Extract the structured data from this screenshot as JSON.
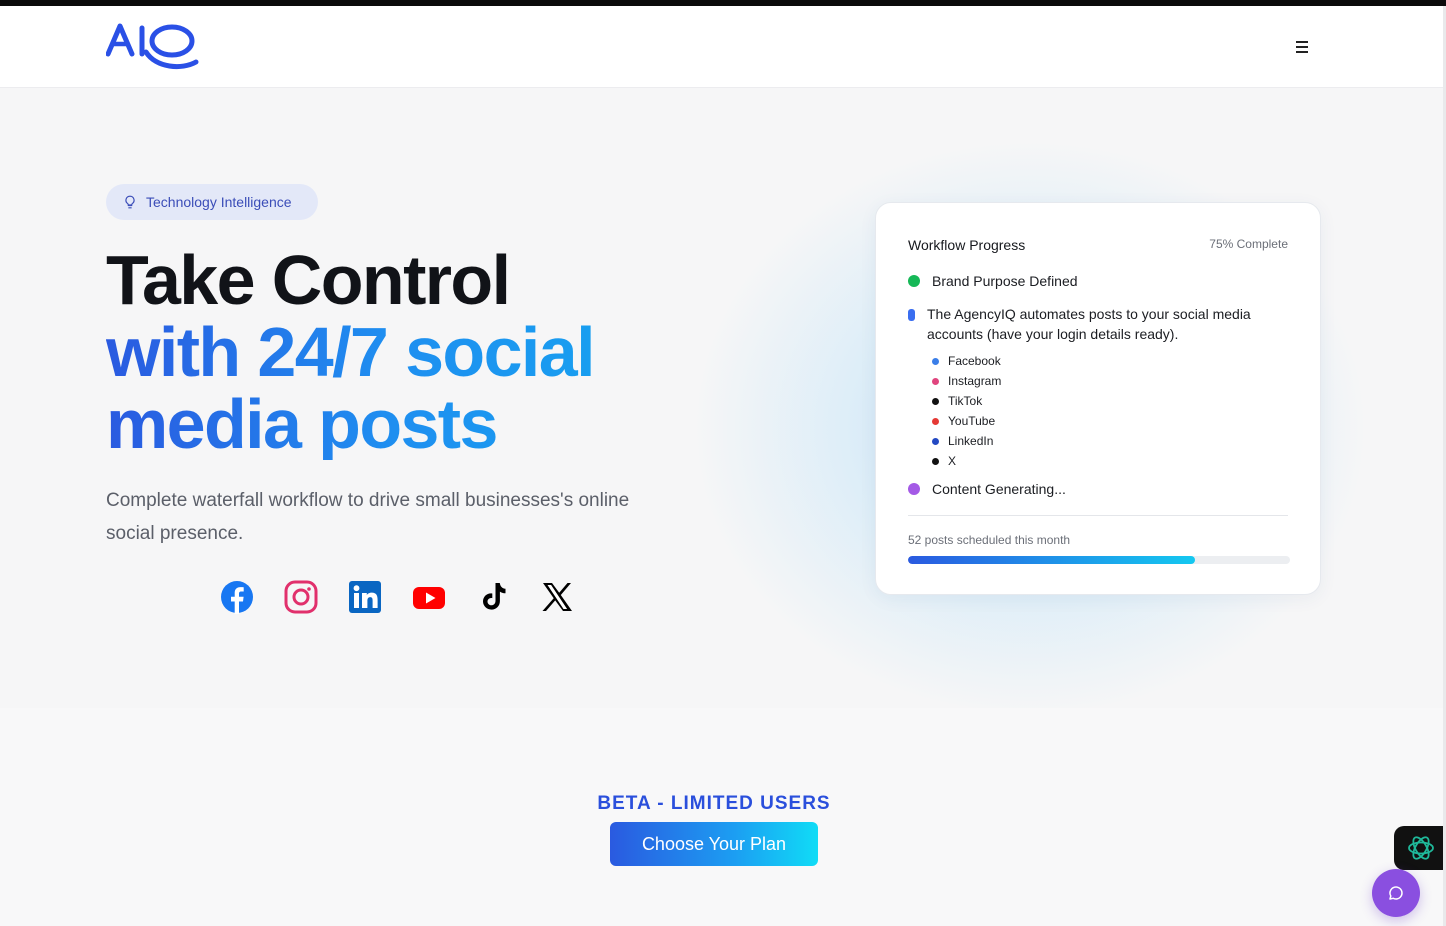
{
  "brand": {
    "logo_text": "AIQ",
    "accent": "#2a5ae0",
    "accent_light": "#14a8f0"
  },
  "header": {
    "menu_icon": "hamburger-menu-icon"
  },
  "hero": {
    "badge": {
      "icon": "lightbulb-icon",
      "label": "Technology Intelligence"
    },
    "headline_line1": "Take Control",
    "headline_line2": "with 24/7 social",
    "headline_line3": "media posts",
    "subtext": "Complete waterfall workflow to drive small businesses's online social presence.",
    "socials": [
      {
        "name": "Facebook",
        "icon": "facebook-icon",
        "color": "#1877f2"
      },
      {
        "name": "Instagram",
        "icon": "instagram-icon",
        "color": "#e1306c"
      },
      {
        "name": "LinkedIn",
        "icon": "linkedin-icon",
        "color": "#0a66c2"
      },
      {
        "name": "YouTube",
        "icon": "youtube-icon",
        "color": "#ff0000"
      },
      {
        "name": "TikTok",
        "icon": "tiktok-icon",
        "color": "#000000"
      },
      {
        "name": "X",
        "icon": "x-icon",
        "color": "#000000"
      }
    ]
  },
  "workflow": {
    "title": "Workflow Progress",
    "completion": "75% Complete",
    "steps": [
      {
        "label": "Brand Purpose Defined",
        "color": "#16b857"
      },
      {
        "label": "The AgencyIQ automates posts to your social media accounts (have your login details ready).",
        "color": "#3a6ef0"
      },
      {
        "label": "Content Generating...",
        "color": "#a45ae6"
      }
    ],
    "platforms": [
      {
        "name": "Facebook",
        "color": "#3a7ee8"
      },
      {
        "name": "Instagram",
        "color": "#e0457e"
      },
      {
        "name": "TikTok",
        "color": "#111111"
      },
      {
        "name": "YouTube",
        "color": "#e53935"
      },
      {
        "name": "LinkedIn",
        "color": "#2449c2"
      },
      {
        "name": "X",
        "color": "#111111"
      }
    ],
    "posts_scheduled": "52 posts scheduled this month",
    "posts_progress": 0.75
  },
  "cta": {
    "beta_label": "BETA - LIMITED USERS",
    "button_label": "Choose Your Plan"
  },
  "widgets": {
    "ai_icon": "openai-icon",
    "chat_icon": "chat-bubble-icon"
  }
}
